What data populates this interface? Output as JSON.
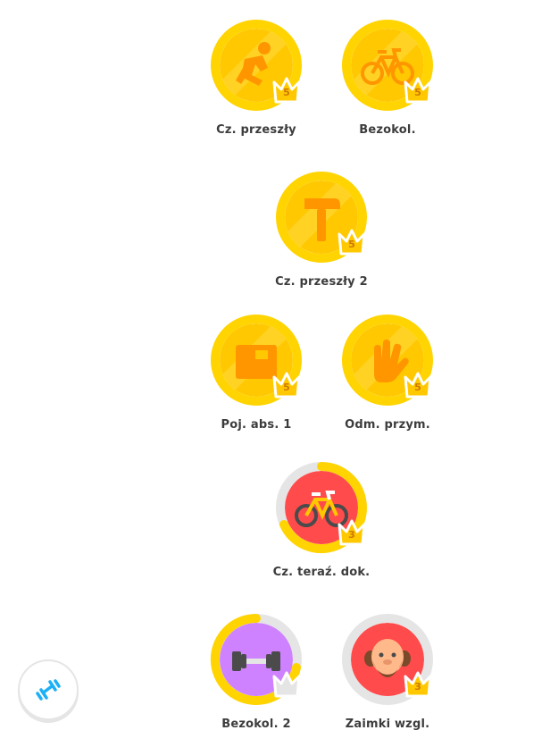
{
  "skills": [
    {
      "name": "Cz. przeszły",
      "level": "5",
      "icon": "running-man-icon",
      "state": "gold"
    },
    {
      "name": "Bezokol.",
      "level": "5",
      "icon": "bicycle-icon",
      "state": "gold"
    },
    {
      "name": "Cz. przeszły 2",
      "level": "5",
      "icon": "hammer-icon",
      "state": "gold"
    },
    {
      "name": "Poj. abs. 1",
      "level": "5",
      "icon": "box-icon",
      "state": "gold"
    },
    {
      "name": "Odm. przym.",
      "level": "5",
      "icon": "hand-icon",
      "state": "gold"
    },
    {
      "name": "Cz. teraź. dok.",
      "level": "3",
      "icon": "bicycle-icon",
      "state": "red",
      "progress": 0.6
    },
    {
      "name": "Bezokol. 2",
      "level": "",
      "icon": "dumbbell-icon",
      "state": "purple",
      "progress": 0.7
    },
    {
      "name": "Zaimki wzgl.",
      "level": "3",
      "icon": "bearded-man-icon",
      "state": "red",
      "progress": 0.0
    }
  ],
  "practice_button": {
    "icon": "dumbbell-practice-icon"
  },
  "colors": {
    "gold": "#ffc800",
    "gold_ring": "#ffd400",
    "red": "#ff4b4b",
    "purple": "#ce82ff",
    "ring_track": "#e5e5e5",
    "crown": "#ffc800",
    "crown_gray": "#e5e5e5"
  }
}
